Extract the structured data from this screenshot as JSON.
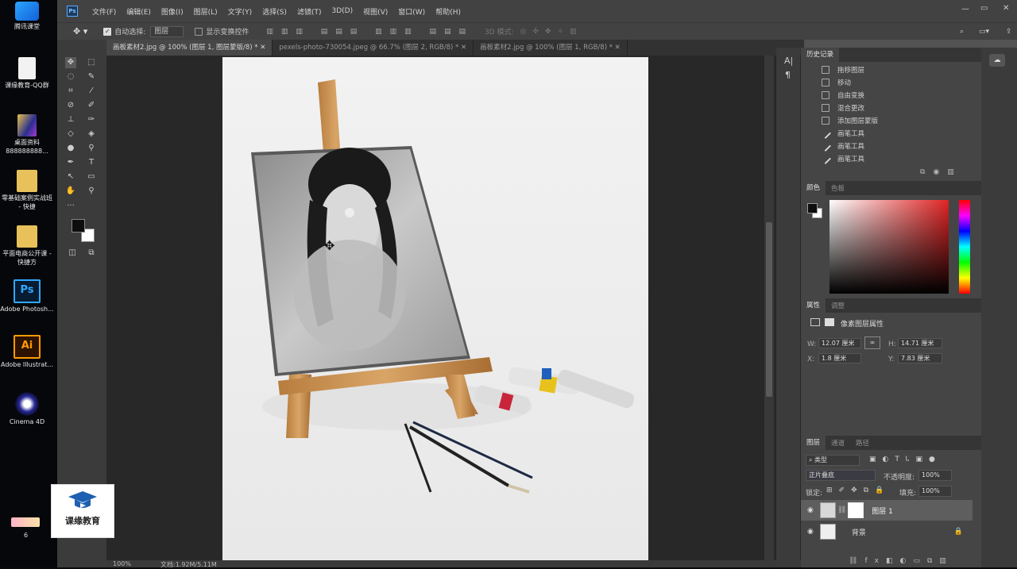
{
  "desktop": {
    "icons": [
      {
        "label": "腾讯课堂",
        "icon": "tencent-classroom-icon"
      },
      {
        "label": "课缘教育-QQ群",
        "icon": "document-icon"
      },
      {
        "label": "桌面资料 888888888...",
        "icon": "folder-icon"
      },
      {
        "label": "零基础案例实战班 - 快捷",
        "icon": "folder-icon"
      },
      {
        "label": "平面电商公开课 - 快捷方",
        "icon": "folder-icon"
      },
      {
        "label": "Adobe Photosh...",
        "icon": "photoshop-icon"
      },
      {
        "label": "Adobe Illustrat...",
        "icon": "illustrator-icon"
      },
      {
        "label": "Cinema 4D",
        "icon": "cinema4d-icon"
      }
    ],
    "watermark": "课缘教育",
    "bottom_label": "6"
  },
  "app": {
    "logo": "Ps",
    "menus": [
      "文件(F)",
      "编辑(E)",
      "图像(I)",
      "图层(L)",
      "文字(Y)",
      "选择(S)",
      "滤镜(T)",
      "3D(D)",
      "视图(V)",
      "窗口(W)",
      "帮助(H)"
    ]
  },
  "options": {
    "auto_select_label": "自动选择:",
    "auto_select_value": "图层",
    "show_transform_label": "显示变换控件",
    "mode_3d_label": "3D 模式:"
  },
  "tabs": [
    {
      "label": "画板素材2.jpg @ 100% (图层 1, 图层蒙版/8) *",
      "active": true
    },
    {
      "label": "pexels-photo-730054.jpeg @ 66.7% (图层 2, RGB/8) *",
      "active": false
    },
    {
      "label": "画板素材2.jpg @ 100% (图层 1, RGB/8) *",
      "active": false
    }
  ],
  "status": {
    "zoom": "100%",
    "doc_info": "文档:1.92M/5.11M"
  },
  "history": {
    "title": "历史记录",
    "items": [
      "拖移图层",
      "移动",
      "自由变换",
      "混合更改",
      "添加图层蒙版",
      "画笔工具",
      "画笔工具",
      "画笔工具"
    ]
  },
  "color_panel": {
    "tabs": [
      "颜色",
      "色板"
    ],
    "fg_color": "#0d0d0d",
    "bg_color": "#ffffff"
  },
  "properties": {
    "tabs": [
      "属性",
      "调整"
    ],
    "type_label": "像素图层属性",
    "w_label": "W:",
    "w_value": "12.07 厘米",
    "h_label": "H:",
    "h_value": "14.71 厘米",
    "x_label": "X:",
    "x_value": "1.8 厘米",
    "y_label": "Y:",
    "y_value": "7.83 厘米"
  },
  "layers_panel": {
    "tabs": [
      "图层",
      "通道",
      "路径"
    ],
    "filter_label": "类型",
    "blend_mode": "正片叠底",
    "opacity_label": "不透明度:",
    "opacity_value": "100%",
    "lock_label": "锁定:",
    "fill_label": "填充:",
    "fill_value": "100%",
    "layers": [
      {
        "name": "图层 1",
        "selected": true
      },
      {
        "name": "背景",
        "selected": false
      }
    ]
  }
}
